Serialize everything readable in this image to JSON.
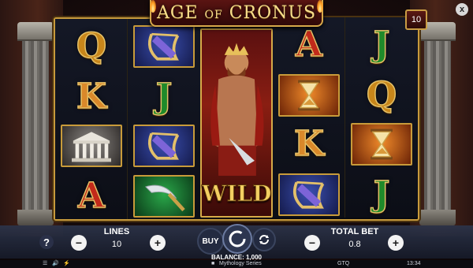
{
  "game": {
    "title_main": "AGE",
    "title_of": "OF",
    "title_rest": "CRONUS",
    "lines_badge": "10",
    "close_glyph": "x"
  },
  "reels": [
    [
      "Q",
      "K",
      "temple",
      "A"
    ],
    [
      "harp",
      "J",
      "harp",
      "sickle"
    ],
    [
      "wild",
      "wild",
      "wild",
      "wild"
    ],
    [
      "A",
      "hourglass",
      "K",
      "harp"
    ],
    [
      "J",
      "Q",
      "hourglass",
      "J"
    ]
  ],
  "wild_label": "WILD",
  "controls": {
    "help_label": "?",
    "lines_label": "LINES",
    "lines_value": "10",
    "minus": "−",
    "plus": "+",
    "buy_label": "BUY",
    "total_bet_label": "TOTAL BET",
    "total_bet_value": "0.8"
  },
  "balance_text": "BALANCE: 1,000",
  "footer": {
    "series": "Mythology Series",
    "currency": "GTQ",
    "time": "13:34"
  },
  "colors": {
    "gold_frame": "#c79a3c",
    "panel": "#2c344a",
    "letter_red": "#c22a1a",
    "letter_green": "#1f8a2a",
    "letter_gold": "#c8861a"
  }
}
